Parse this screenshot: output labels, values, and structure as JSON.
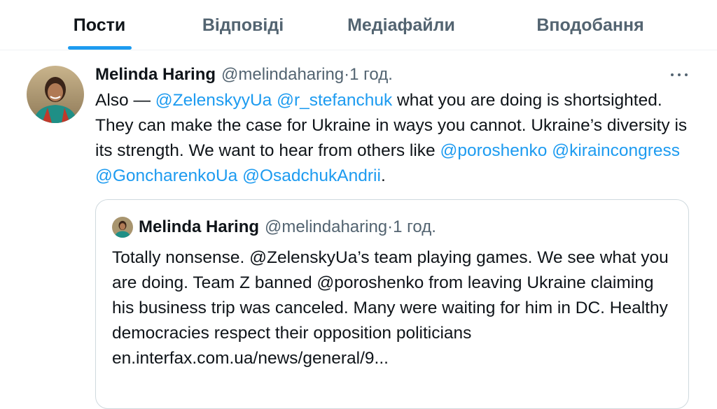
{
  "tabs": [
    {
      "label": "Пости",
      "active": true
    },
    {
      "label": "Відповіді",
      "active": false
    },
    {
      "label": "Медіафайли",
      "active": false
    },
    {
      "label": "Вподобання",
      "active": false
    }
  ],
  "colors": {
    "accent": "#1d9bf0",
    "text_primary": "#0f1419",
    "text_secondary": "#536471",
    "border": "#cfd9de"
  },
  "tweet": {
    "author_name": "Melinda Haring",
    "author_handle": "@melindaharing",
    "separator": " · ",
    "time": "1 год.",
    "more_icon": "more-horizontal-icon",
    "body": {
      "t1": "Also — ",
      "m1": "@ZelenskyyUa",
      "sp1": " ",
      "m2": "@r_stefanchuk",
      "t2": " what you are doing is shortsighted. They can make the case for Ukraine in ways you cannot. Ukraine’s diversity is its strength. We want to hear from others like ",
      "m3": "@poroshenko",
      "sp2": " ",
      "m4": "@kiraincongress",
      "sp3": " ",
      "m5": "@GoncharenkoUa",
      "sp4": " ",
      "m6": "@OsadchukAndrii",
      "t3": "."
    },
    "quote": {
      "author_name": "Melinda Haring",
      "author_handle": "@melindaharing",
      "separator": " · ",
      "time": "1 год.",
      "text": "Totally nonsense. @ZelenskyUa’s team playing games. We see what you are doing. Team Z banned @poroshenko from leaving Ukraine claiming his business trip was canceled. Many were waiting for him in DC. Healthy democracies respect their opposition politicians en.interfax.com.ua/news/general/9..."
    }
  }
}
